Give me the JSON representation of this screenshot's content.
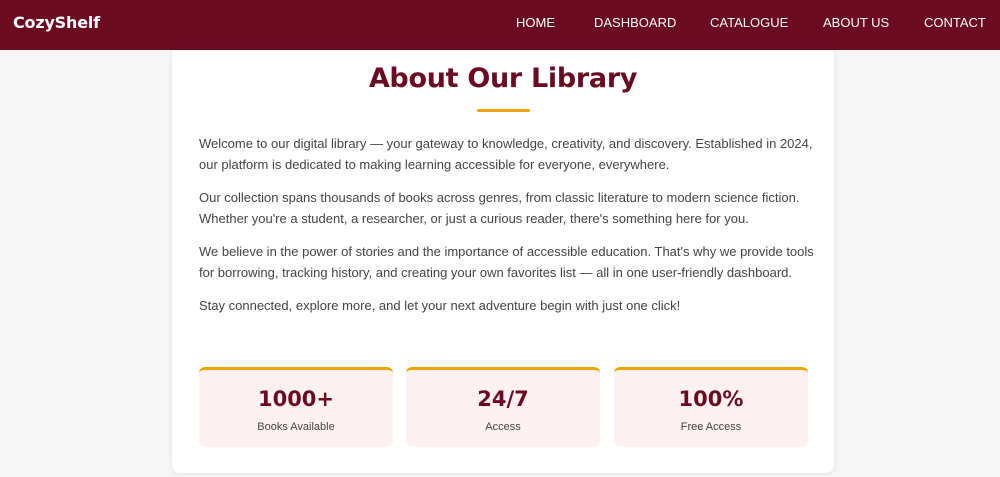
{
  "header": {
    "brand": "CozyShelf",
    "nav": [
      "HOME",
      "DASHBOARD",
      "CATALOGUE",
      "ABOUT US",
      "CONTACT"
    ]
  },
  "about": {
    "title": "About Our Library",
    "paragraphs": [
      "Welcome to our digital library — your gateway to knowledge, creativity, and discovery. Established in 2024, our platform is dedicated to making learning accessible for everyone, everywhere.",
      "Our collection spans thousands of books across genres, from classic literature to modern science fiction. Whether you're a student, a researcher, or just a curious reader, there's something here for you.",
      "We believe in the power of stories and the importance of accessible education. That's why we provide tools for borrowing, tracking history, and creating your own favorites list — all in one user-friendly dashboard.",
      "Stay connected, explore more, and let your next adventure begin with just one click!"
    ],
    "stats": [
      {
        "value": "1000+",
        "label": "Books Available"
      },
      {
        "value": "24/7",
        "label": "Access"
      },
      {
        "value": "100%",
        "label": "Free Access"
      }
    ]
  },
  "colors": {
    "brand": "#6a0b22",
    "accent": "#f0a500",
    "stat_bg": "#fdf1f2"
  }
}
